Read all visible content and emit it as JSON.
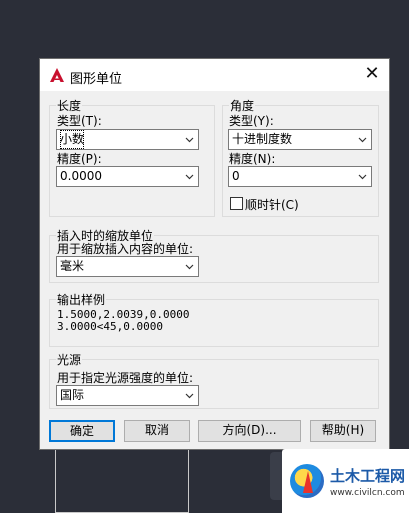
{
  "dialog": {
    "title": "图形单位",
    "close_glyph": "✕"
  },
  "length": {
    "legend": "长度",
    "type_label": "类型(T):",
    "type_value": "小数",
    "precision_label": "精度(P):",
    "precision_value": "0.0000"
  },
  "angle": {
    "legend": "角度",
    "type_label": "类型(Y):",
    "type_value": "十进制度数",
    "precision_label": "精度(N):",
    "precision_value": "0",
    "clockwise_label": "顺时针(C)",
    "clockwise_checked": false
  },
  "insertion": {
    "legend": "插入时的缩放单位",
    "label": "用于缩放插入内容的单位:",
    "value": "毫米"
  },
  "sample_output": {
    "legend": "输出样例",
    "line1": "1.5000,2.0039,0.0000",
    "line2": "3.0000<45,0.0000"
  },
  "lighting": {
    "legend": "光源",
    "label": "用于指定光源强度的单位:",
    "value": "国际"
  },
  "buttons": {
    "ok": "确定",
    "cancel": "取消",
    "direction": "方向(D)...",
    "help": "帮助(H)"
  },
  "watermark": {
    "name": "土木工程网",
    "url": "www.civilcn.com"
  },
  "colors": {
    "accent": "#0078d7",
    "app_icon": "#c8102e",
    "background": "#2b2e38"
  }
}
